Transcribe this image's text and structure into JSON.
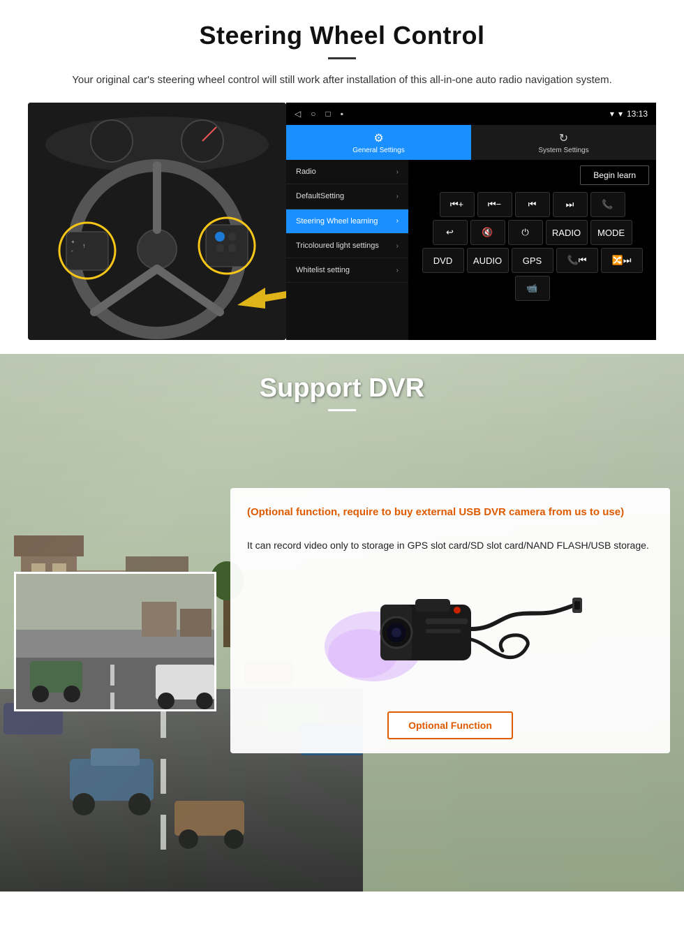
{
  "steering": {
    "title": "Steering Wheel Control",
    "description": "Your original car's steering wheel control will still work after installation of this all-in-one auto radio navigation system.",
    "statusbar": {
      "time": "13:13",
      "nav_back": "◁",
      "nav_home": "○",
      "nav_square": "□",
      "nav_dot": "▪"
    },
    "tabs": {
      "general": {
        "icon": "⚙",
        "label": "General Settings"
      },
      "system": {
        "icon": "🔁",
        "label": "System Settings"
      }
    },
    "menu": [
      {
        "label": "Radio",
        "active": false
      },
      {
        "label": "DefaultSetting",
        "active": false
      },
      {
        "label": "Steering Wheel learning",
        "active": true
      },
      {
        "label": "Tricoloured light settings",
        "active": false
      },
      {
        "label": "Whitelist setting",
        "active": false
      }
    ],
    "begin_learn": "Begin learn",
    "control_buttons": [
      [
        "⏮+",
        "⏮-",
        "⏮⏮",
        "⏭⏭",
        "📞"
      ],
      [
        "↩",
        "🔇x",
        "⏻",
        "RADIO",
        "MODE"
      ],
      [
        "DVD",
        "AUDIO",
        "GPS",
        "📞⏮",
        "🔀⏭"
      ],
      [
        "📹"
      ]
    ]
  },
  "dvr": {
    "title": "Support DVR",
    "optional_text": "(Optional function, require to buy external USB DVR camera from us to use)",
    "description": "It can record video only to storage in GPS slot card/SD slot card/NAND FLASH/USB storage.",
    "optional_btn_label": "Optional Function"
  }
}
